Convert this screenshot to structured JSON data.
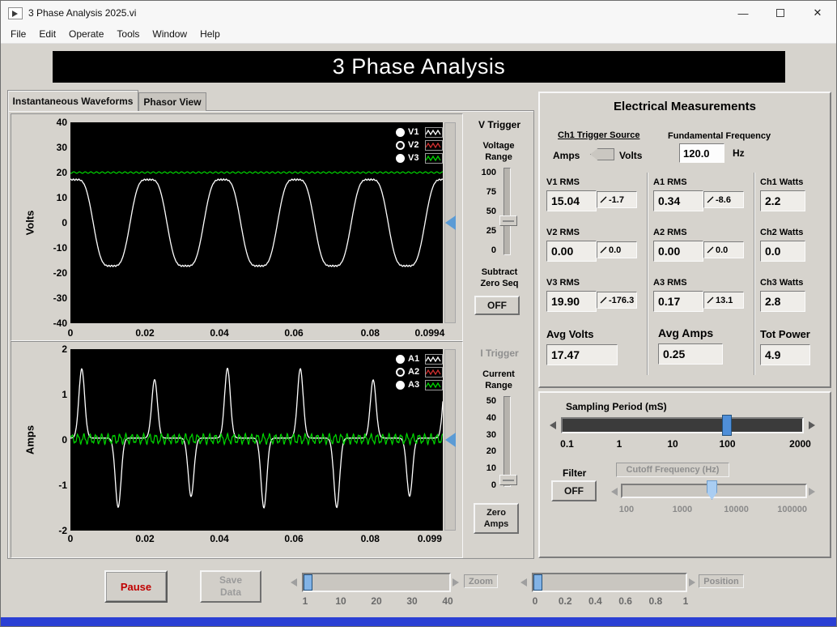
{
  "window": {
    "title": "3 Phase Analysis 2025.vi",
    "menus": [
      "File",
      "Edit",
      "Operate",
      "Tools",
      "Window",
      "Help"
    ],
    "banner": "3 Phase Analysis",
    "controls": {
      "minimize": "—",
      "close": "✕"
    }
  },
  "tabs": {
    "waveforms": "Instantaneous Waveforms",
    "phasor": "Phasor View"
  },
  "volt_graph": {
    "ylabel": "Volts",
    "y_ticks": [
      "40",
      "30",
      "20",
      "10",
      "0",
      "-10",
      "-20",
      "-30",
      "-40"
    ],
    "x_ticks": [
      "0",
      "0.02",
      "0.04",
      "0.06",
      "0.08",
      "0.0994"
    ],
    "legend": [
      {
        "label": "V1",
        "selected": true
      },
      {
        "label": "V2",
        "selected": false
      },
      {
        "label": "V3",
        "selected": true
      }
    ]
  },
  "amp_graph": {
    "ylabel": "Amps",
    "y_ticks": [
      "2",
      "1",
      "0",
      "-1",
      "-2"
    ],
    "x_ticks": [
      "0",
      "0.02",
      "0.04",
      "0.06",
      "0.08",
      "0.099"
    ],
    "legend": [
      {
        "label": "A1",
        "selected": true
      },
      {
        "label": "A2",
        "selected": false
      },
      {
        "label": "A3",
        "selected": true
      }
    ]
  },
  "v_trigger": {
    "title": "V Trigger",
    "range_label": "Voltage Range",
    "scale": [
      "100",
      "75",
      "50",
      "25",
      "0"
    ],
    "subtract_label": "Subtract Zero Seq",
    "off_button": "OFF"
  },
  "i_trigger": {
    "title": "I Trigger",
    "range_label": "Current Range",
    "scale": [
      "50",
      "40",
      "30",
      "20",
      "10",
      "0"
    ],
    "zero_button": "Zero Amps"
  },
  "measurements": {
    "title": "Electrical Measurements",
    "trigger_source_label": "Ch1 Trigger Source",
    "switch_left": "Amps",
    "switch_right": "Volts",
    "freq_label": "Fundamental Frequency",
    "freq_value": "120.0",
    "freq_unit": "Hz",
    "columns": [
      {
        "rows": [
          {
            "label": "V1 RMS",
            "value": "15.04",
            "angle": "-1.7"
          },
          {
            "label": "V2 RMS",
            "value": "0.00",
            "angle": "0.0"
          },
          {
            "label": "V3 RMS",
            "value": "19.90",
            "angle": "-176.3"
          }
        ],
        "avg_label": "Avg Volts",
        "avg_value": "17.47"
      },
      {
        "rows": [
          {
            "label": "A1 RMS",
            "value": "0.34",
            "angle": "-8.6"
          },
          {
            "label": "A2 RMS",
            "value": "0.00",
            "angle": "0.0"
          },
          {
            "label": "A3 RMS",
            "value": "0.17",
            "angle": "13.1"
          }
        ],
        "avg_label": "Avg Amps",
        "avg_value": "0.25"
      },
      {
        "rows": [
          {
            "label": "Ch1 Watts",
            "value": "2.2"
          },
          {
            "label": "Ch2 Watts",
            "value": "0.0"
          },
          {
            "label": "Ch3 Watts",
            "value": "2.8"
          }
        ],
        "avg_label": "Tot Power",
        "avg_value": "4.9"
      }
    ]
  },
  "sampling": {
    "label": "Sampling Period (mS)",
    "scale": [
      "0.1",
      "1",
      "10",
      "100",
      "2000"
    ],
    "filter_label": "Filter",
    "filter_button": "OFF",
    "cutoff_label": "Cutoff Frequency (Hz)",
    "cutoff_scale": [
      "100",
      "1000",
      "10000",
      "100000"
    ]
  },
  "bottom": {
    "pause_button": "Pause",
    "save_button": "Save Data",
    "zoom_label": "Zoom",
    "zoom_scale": [
      "1",
      "10",
      "20",
      "30",
      "40"
    ],
    "position_label": "Position",
    "position_scale": [
      "0",
      "0.2",
      "0.4",
      "0.6",
      "0.8",
      "1"
    ]
  },
  "colors": {
    "trace_v1": "#ffffff",
    "trace_v2": "#d03030",
    "trace_v3": "#00d600",
    "accent_blue": "#5b9bd5",
    "taskbar_blue": "#2a3fd4",
    "pause_text_red": "#c00000"
  },
  "waveforms": {
    "volts": {
      "amplitude": 19.5,
      "third_harmonic": 0.12,
      "cycles": 5.05,
      "phase": 1.2,
      "ripple": 0.7,
      "green_level": 20,
      "green_ripple": 0.3,
      "y_range": 40
    },
    "amps": {
      "spike_amplitude": 1.5,
      "baseline": 0.04,
      "up_offset": 14,
      "down_offset": 59,
      "spacing": 90,
      "sigma": 5,
      "green_ripple": 0.09,
      "y_range": 2
    }
  }
}
